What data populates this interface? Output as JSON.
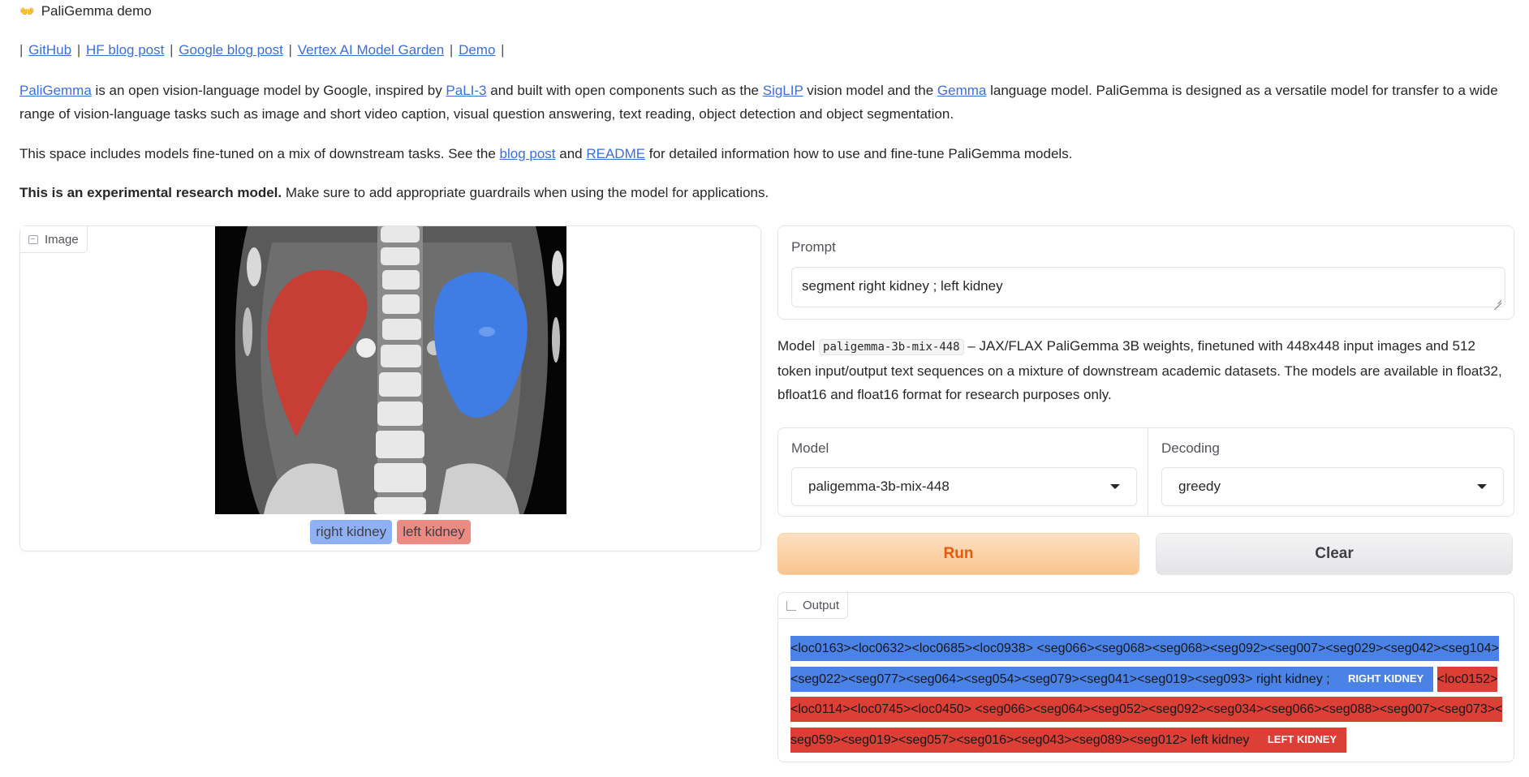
{
  "app": {
    "icon": "hands-icon",
    "title": "PaliGemma demo"
  },
  "links": {
    "separator": "|",
    "items": [
      "GitHub",
      "HF blog post",
      "Google blog post",
      "Vertex AI Model Garden",
      "Demo"
    ]
  },
  "intro": {
    "paligemma_link": "PaliGemma",
    "t1": " is an open vision-language model by Google, inspired by ",
    "pali3_link": "PaLI-3",
    "t2": " and built with open components such as the ",
    "siglip_link": "SigLIP",
    "t3": " vision model and the ",
    "gemma_link": "Gemma",
    "t4": " language model. PaliGemma is designed as a versatile model for transfer to a wide range of vision-language tasks such as image and short video caption, visual question answering, text reading, object detection and object segmentation."
  },
  "space_info": {
    "t1": "This space includes models fine-tuned on a mix of downstream tasks. See the ",
    "blog_link": "blog post",
    "t2": " and ",
    "readme_link": "README",
    "t3": " for detailed information how to use and fine-tune PaliGemma models."
  },
  "warning": {
    "bold": "This is an experimental research model.",
    "rest": " Make sure to add appropriate guardrails when using the model for applications."
  },
  "image_panel": {
    "label": "Image",
    "legend": [
      "right kidney",
      "left kidney"
    ],
    "colors": {
      "right_kidney": "#8fb1f3",
      "left_kidney": "#ec8a84"
    }
  },
  "prompt": {
    "label": "Prompt",
    "value": "segment right kidney ; left kidney"
  },
  "model_desc": {
    "prefix": "Model ",
    "code": "paligemma-3b-mix-448",
    "rest": " – JAX/FLAX PaliGemma 3B weights, finetuned with 448x448 input images and 512 token input/output text sequences on a mixture of downstream academic datasets. The models are available in float32, bfloat16 and float16 format for research purposes only."
  },
  "model_select": {
    "label": "Model",
    "value": "paligemma-3b-mix-448"
  },
  "decoding_select": {
    "label": "Decoding",
    "value": "greedy"
  },
  "buttons": {
    "run": "Run",
    "clear": "Clear"
  },
  "output": {
    "label": "Output",
    "segments": [
      {
        "text": "<loc0163><loc0632><loc0685><loc0938> <seg066><seg068><seg068><seg092><seg007><seg029><seg042><seg104><seg022><seg077><seg064><seg054><seg079><seg041><seg019><seg093> right kidney ;",
        "badge": "RIGHT KIDNEY",
        "color": "#4a82e6"
      },
      {
        "text": "<loc0152><loc0114><loc0745><loc0450> <seg066><seg064><seg052><seg092><seg034><seg066><seg088><seg007><seg073><seg059><seg019><seg057><seg016><seg043><seg089><seg012> left kidney",
        "badge": "LEFT KIDNEY",
        "color": "#db3f36"
      }
    ]
  }
}
